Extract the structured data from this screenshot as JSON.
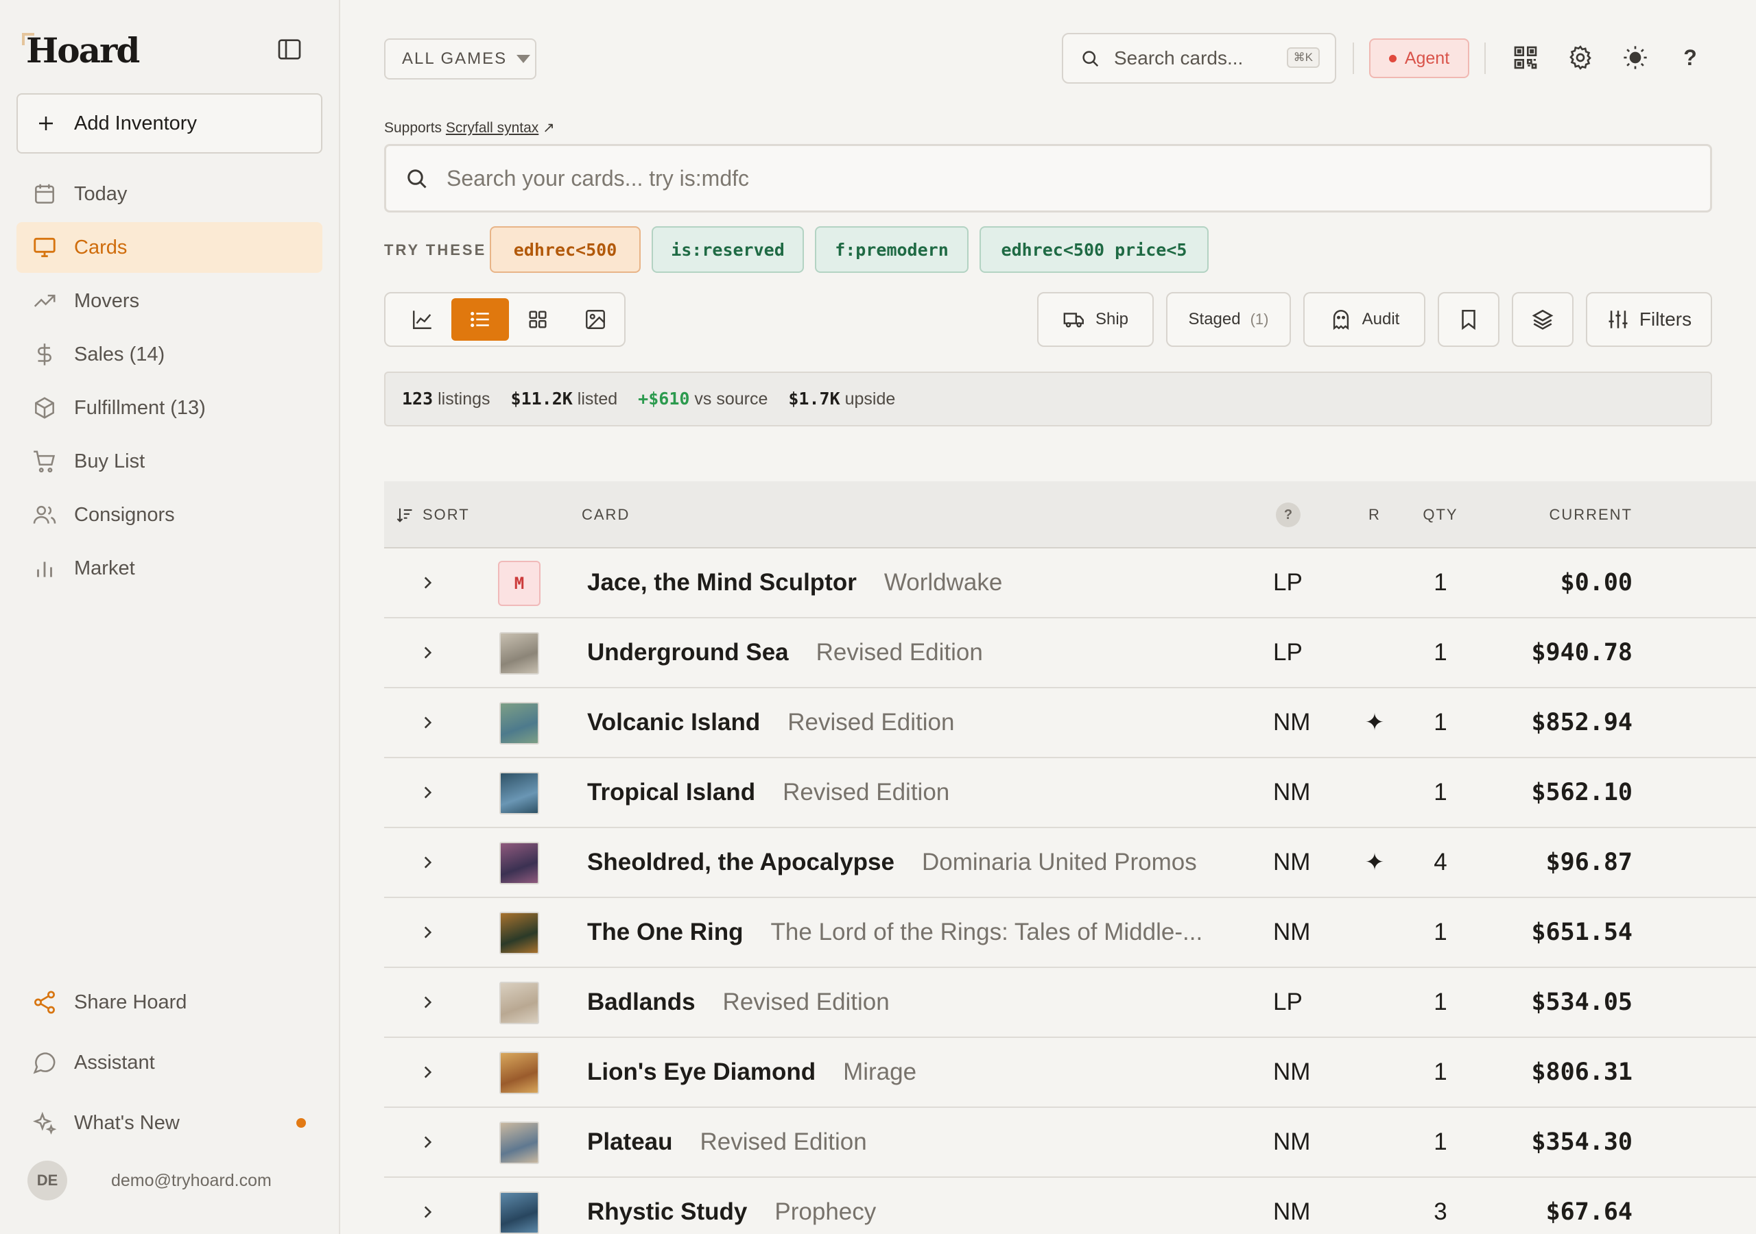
{
  "app": {
    "name": "Hoard"
  },
  "sidebar": {
    "add_inventory": "Add Inventory",
    "items": [
      {
        "label": "Today",
        "icon": "calendar-icon"
      },
      {
        "label": "Cards",
        "icon": "monitor-icon",
        "active": true
      },
      {
        "label": "Movers",
        "icon": "trending-up-icon"
      },
      {
        "label": "Sales (14)",
        "icon": "dollar-icon"
      },
      {
        "label": "Fulfillment (13)",
        "icon": "box-icon"
      },
      {
        "label": "Buy List",
        "icon": "cart-icon"
      },
      {
        "label": "Consignors",
        "icon": "users-icon"
      },
      {
        "label": "Market",
        "icon": "bar-chart-icon"
      }
    ],
    "bottom": [
      {
        "label": "Share Hoard",
        "icon": "share-icon"
      },
      {
        "label": "Assistant",
        "icon": "chat-icon"
      },
      {
        "label": "What's New",
        "icon": "sparkle-icon"
      }
    ],
    "user": {
      "initials": "DE",
      "email": "demo@tryhoard.com"
    }
  },
  "topbar": {
    "games_select": "ALL GAMES",
    "search_placeholder": "Search cards...",
    "search_shortcut": "⌘K",
    "agent_label": "Agent"
  },
  "search": {
    "supports_prefix": "Supports",
    "supports_link": "Scryfall syntax",
    "supports_arrow": "↗",
    "placeholder": "Search your cards... try is:mdfc",
    "try_label": "TRY THESE",
    "chips": [
      "edhrec<500",
      "is:reserved",
      "f:premodern",
      "edhrec<500 price<5"
    ]
  },
  "toolbar": {
    "ship": "Ship",
    "staged": "Staged",
    "staged_count": "(1)",
    "audit": "Audit",
    "filters": "Filters"
  },
  "stats": {
    "listings_value": "123",
    "listings_label": "listings",
    "listed_value": "$11.2K",
    "listed_label": "listed",
    "source_value": "+$610",
    "source_label": "vs source",
    "upside_value": "$1.7K",
    "upside_label": "upside"
  },
  "table": {
    "headers": {
      "sort": "SORT",
      "card": "CARD",
      "help": "?",
      "r": "R",
      "qty": "QTY",
      "current": "CURRENT"
    },
    "rows": [
      {
        "name": "Jace, the Mind Sculptor",
        "set": "Worldwake",
        "cond": "LP",
        "r": "",
        "qty": "1",
        "price": "$0.00",
        "thumb": "M",
        "colors": [
          "#fbe2e2",
          "#fbe2e2"
        ]
      },
      {
        "name": "Underground Sea",
        "set": "Revised Edition",
        "cond": "LP",
        "r": "",
        "qty": "1",
        "price": "$940.78",
        "colors": [
          "#8c8578",
          "#c7bfb0"
        ]
      },
      {
        "name": "Volcanic Island",
        "set": "Revised Edition",
        "cond": "NM",
        "r": "✦",
        "qty": "1",
        "price": "$852.94",
        "colors": [
          "#4d7a8c",
          "#7d9f86"
        ]
      },
      {
        "name": "Tropical Island",
        "set": "Revised Edition",
        "cond": "NM",
        "r": "",
        "qty": "1",
        "price": "$562.10",
        "colors": [
          "#6a96b4",
          "#2f5266"
        ]
      },
      {
        "name": "Sheoldred, the Apocalypse",
        "set": "Dominaria United Promos",
        "cond": "NM",
        "r": "✦",
        "qty": "4",
        "price": "$96.87",
        "colors": [
          "#3b3152",
          "#8f5a7d"
        ]
      },
      {
        "name": "The One Ring",
        "set": "The Lord of the Rings: Tales of Middle-...",
        "cond": "NM",
        "r": "",
        "qty": "1",
        "price": "$651.54",
        "colors": [
          "#2b3a28",
          "#a8722e"
        ]
      },
      {
        "name": "Badlands",
        "set": "Revised Edition",
        "cond": "LP",
        "r": "",
        "qty": "1",
        "price": "$534.05",
        "colors": [
          "#b9a892",
          "#d9cfbf"
        ]
      },
      {
        "name": "Lion's Eye Diamond",
        "set": "Mirage",
        "cond": "NM",
        "r": "",
        "qty": "1",
        "price": "$806.31",
        "colors": [
          "#9a5b2c",
          "#d8a75c"
        ]
      },
      {
        "name": "Plateau",
        "set": "Revised Edition",
        "cond": "NM",
        "r": "",
        "qty": "1",
        "price": "$354.30",
        "colors": [
          "#5f7890",
          "#c9b8a0"
        ]
      },
      {
        "name": "Rhystic Study",
        "set": "Prophecy",
        "cond": "NM",
        "r": "",
        "qty": "3",
        "price": "$67.64",
        "colors": [
          "#28465f",
          "#5c88a8"
        ]
      }
    ]
  },
  "colors": {
    "accent": "#e0780e",
    "accent_bg": "#fbead4",
    "positive": "#2c9a4e",
    "agent": "#d9534a"
  }
}
